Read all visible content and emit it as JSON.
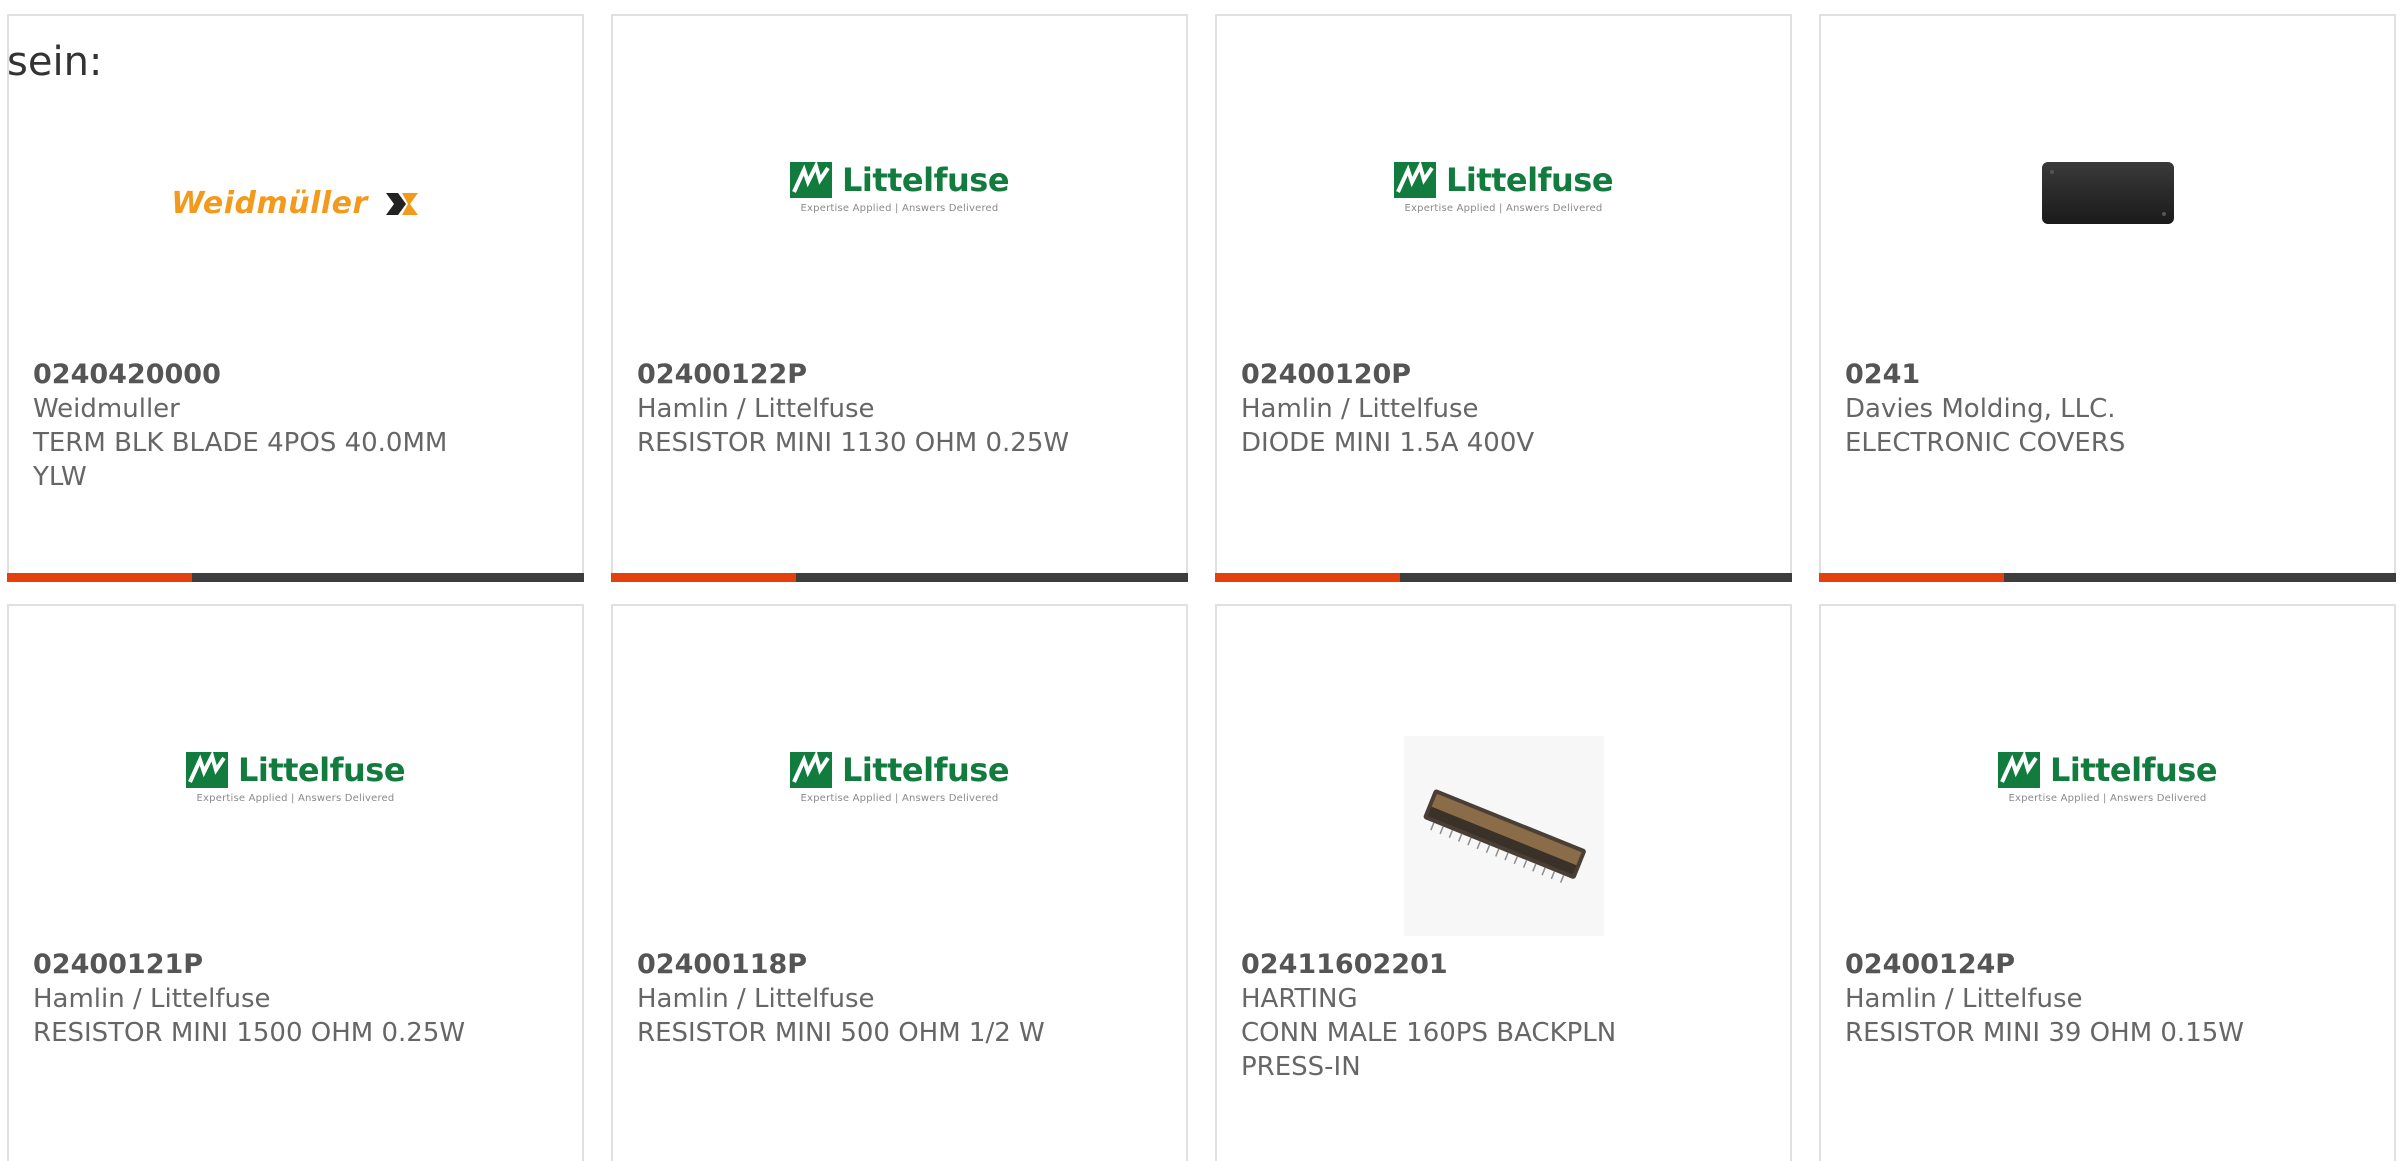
{
  "intro_text": "sein:",
  "logos": {
    "weidmuller": "Weidmüller",
    "littelfuse": "Littelfuse",
    "littelfuse_tagline": "Expertise Applied | Answers Delivered"
  },
  "products": [
    {
      "part_number": "0240420000",
      "manufacturer": "Weidmuller",
      "description": "TERM BLK BLADE 4POS 40.0MM YLW",
      "image": "weidmuller-logo",
      "progress": 0.32
    },
    {
      "part_number": "02400122P",
      "manufacturer": "Hamlin / Littelfuse",
      "description": "RESISTOR MINI 1130 OHM 0.25W",
      "image": "littelfuse-logo",
      "progress": 0.32
    },
    {
      "part_number": "02400120P",
      "manufacturer": "Hamlin / Littelfuse",
      "description": "DIODE MINI 1.5A 400V",
      "image": "littelfuse-logo",
      "progress": 0.32
    },
    {
      "part_number": "0241",
      "manufacturer": "Davies Molding, LLC.",
      "description": "ELECTRONIC COVERS",
      "image": "black-cover-photo",
      "progress": 0.32
    },
    {
      "part_number": "02400121P",
      "manufacturer": "Hamlin / Littelfuse",
      "description": "RESISTOR MINI 1500 OHM 0.25W",
      "image": "littelfuse-logo"
    },
    {
      "part_number": "02400118P",
      "manufacturer": "Hamlin / Littelfuse",
      "description": "RESISTOR MINI 500 OHM 1/2 W",
      "image": "littelfuse-logo"
    },
    {
      "part_number": "02411602201",
      "manufacturer": "HARTING",
      "description": "CONN MALE 160PS BACKPLN PRESS-IN",
      "image": "connector-photo"
    },
    {
      "part_number": "02400124P",
      "manufacturer": "Hamlin / Littelfuse",
      "description": "RESISTOR MINI 39 OHM 0.15W",
      "image": "littelfuse-logo"
    }
  ],
  "colors": {
    "accent": "#e4400f",
    "bar_track": "#3d3d3d",
    "card_border": "#e0e0e0",
    "littelfuse_green": "#127c3f",
    "weidmuller_orange": "#f39a1c"
  }
}
